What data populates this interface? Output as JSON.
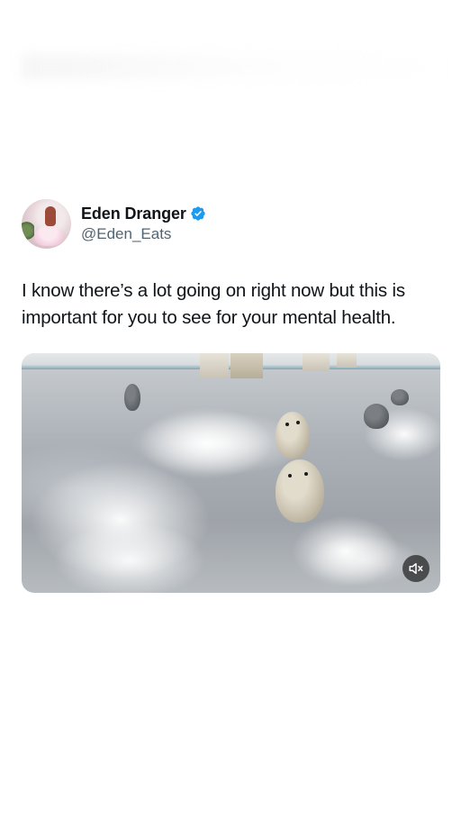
{
  "tweet": {
    "author": {
      "display_name": "Eden Dranger",
      "handle": "@Eden_Eats",
      "verified": true,
      "verified_color": "#1d9bf0"
    },
    "text": "I know there’s a lot going on right now but this is important for you to see for your mental health.",
    "media": {
      "type": "video",
      "muted_icon": "speaker-muted-icon"
    }
  }
}
